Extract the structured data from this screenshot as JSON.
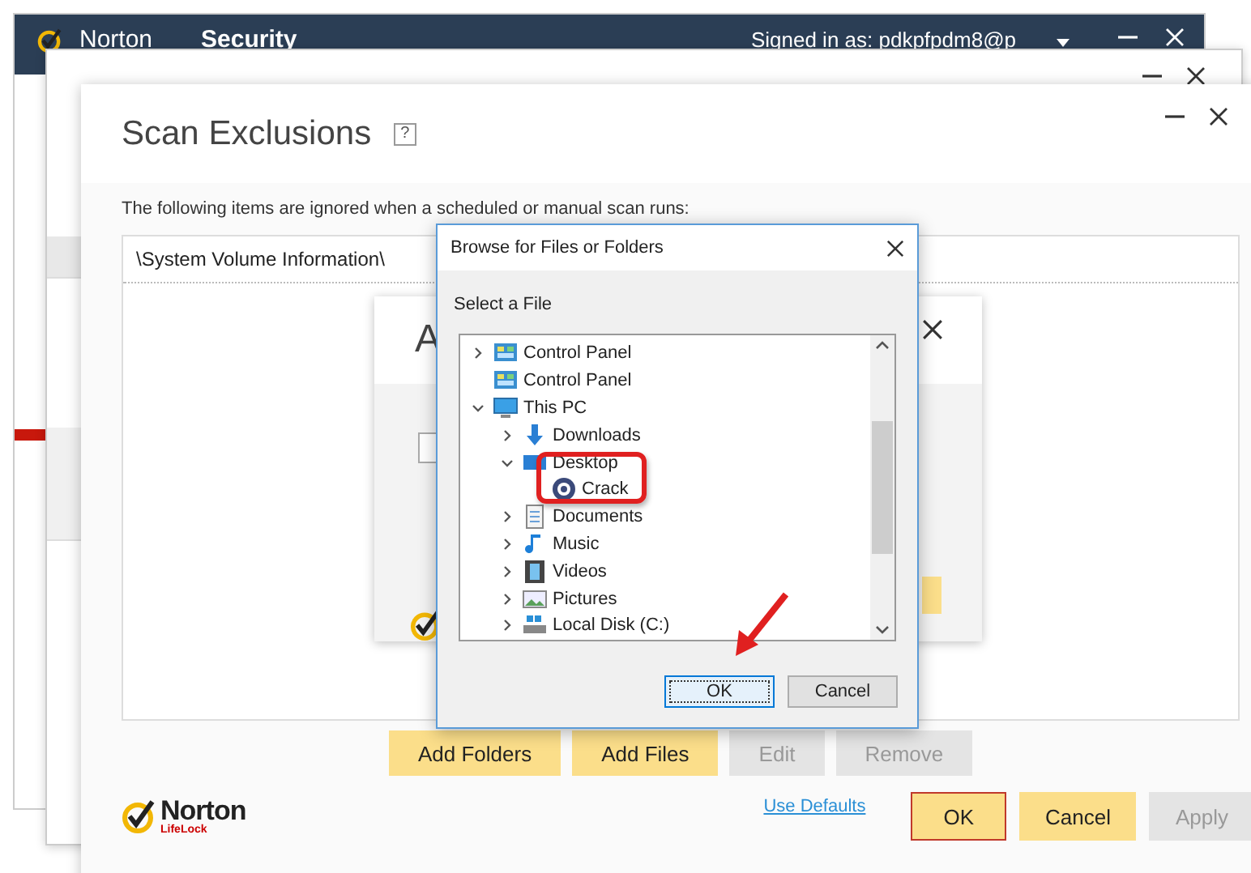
{
  "main_window": {
    "brand": "Norton",
    "title": "Security",
    "account": "Signed in as: pdkpfpdm8@p"
  },
  "scan_exclusions": {
    "title": "Scan Exclusions",
    "help": "?",
    "description": "The following items are ignored when a scheduled or manual scan runs:",
    "items": [
      "\\System Volume Information\\"
    ],
    "inner_dialog": {
      "title": "A"
    },
    "buttons": [
      {
        "label": "Add Folders",
        "disabled": false
      },
      {
        "label": "Add Files",
        "disabled": false
      },
      {
        "label": "Edit",
        "disabled": true
      },
      {
        "label": "Remove",
        "disabled": true
      }
    ],
    "logo": {
      "name": "Norton",
      "sub": "LifeLock"
    },
    "link": "Use Defaults",
    "footer_buttons": [
      {
        "label": "OK",
        "disabled": false,
        "focused": true
      },
      {
        "label": "Cancel",
        "disabled": false,
        "focused": false
      },
      {
        "label": "Apply",
        "disabled": true,
        "focused": false
      }
    ]
  },
  "browse_dialog": {
    "title": "Browse for Files or Folders",
    "prompt": "Select a File",
    "tree": [
      {
        "label": "Control Panel",
        "kind": "panel",
        "expandable": true,
        "expanded": false
      },
      {
        "label": "Control Panel",
        "kind": "panel",
        "expandable": false
      },
      {
        "label": "This PC",
        "kind": "computer",
        "expandable": true,
        "expanded": true,
        "children": [
          {
            "label": "Downloads",
            "kind": "downloads",
            "expandable": true,
            "expanded": false
          },
          {
            "label": "Desktop",
            "kind": "desktop",
            "expandable": true,
            "expanded": true,
            "children": [
              {
                "label": "Crack",
                "kind": "app",
                "expandable": false
              }
            ]
          },
          {
            "label": "Documents",
            "kind": "documents",
            "expandable": true,
            "expanded": false
          },
          {
            "label": "Music",
            "kind": "music",
            "expandable": true,
            "expanded": false
          },
          {
            "label": "Videos",
            "kind": "videos",
            "expandable": true,
            "expanded": false
          },
          {
            "label": "Pictures",
            "kind": "pictures",
            "expandable": true,
            "expanded": false
          },
          {
            "label": "Local Disk (C:)",
            "kind": "disk",
            "expandable": true,
            "expanded": false
          }
        ]
      }
    ],
    "buttons": [
      {
        "label": "OK",
        "focused": true
      },
      {
        "label": "Cancel",
        "focused": false
      }
    ]
  }
}
